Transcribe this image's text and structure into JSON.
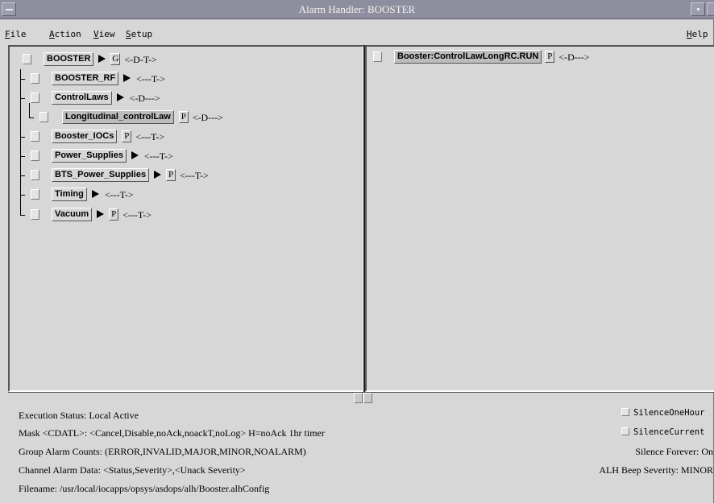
{
  "window": {
    "title": "Alarm Handler: BOOSTER"
  },
  "menu": {
    "file": "File",
    "action": "Action",
    "view": "View",
    "setup": "Setup",
    "help": "Help"
  },
  "tree": [
    {
      "label": "BOOSTER",
      "box": "G",
      "mask": "<-D-T->",
      "has_arrow": true,
      "selected": false
    },
    {
      "label": "BOOSTER_RF",
      "box": "",
      "mask": "<---T->",
      "has_arrow": true,
      "selected": false
    },
    {
      "label": "ControlLaws",
      "box": "",
      "mask": "<-D--->",
      "has_arrow": true,
      "selected": false
    },
    {
      "label": "Longitudinal_controlLaw",
      "box": "P",
      "mask": "<-D--->",
      "has_arrow": false,
      "selected": true
    },
    {
      "label": "Booster_IOCs",
      "box": "P",
      "mask": "<---T->",
      "has_arrow": false,
      "selected": false
    },
    {
      "label": "Power_Supplies",
      "box": "",
      "mask": "<---T->",
      "has_arrow": true,
      "selected": false
    },
    {
      "label": "BTS_Power_Supplies",
      "box": "P",
      "mask": "<---T->",
      "has_arrow": true,
      "selected": false
    },
    {
      "label": "Timing",
      "box": "",
      "mask": "<---T->",
      "has_arrow": true,
      "selected": false
    },
    {
      "label": "Vacuum",
      "box": "P",
      "mask": "<---T->",
      "has_arrow": true,
      "selected": false
    }
  ],
  "channels": [
    {
      "label": "Booster:ControlLawLongRC.RUN",
      "box": "P",
      "mask": "<-D--->"
    }
  ],
  "status": {
    "execution": "Execution Status:  Local Active",
    "mask": "Mask <CDATL>:  <Cancel,Disable,noAck,noackT,noLog>     H=noAck 1hr timer",
    "group_counts": "Group Alarm Counts:  (ERROR,INVALID,MAJOR,MINOR,NOALARM)",
    "channel_data": "Channel Alarm Data:  <Status,Severity>,<Unack Severity>",
    "filename": "Filename:   /usr/local/iocapps/opsys/asdops/alh/Booster.alhConfig"
  },
  "right_status": {
    "silence_one_hour": "SilenceOneHour",
    "silence_current": "SilenceCurrent",
    "silence_forever": "Silence Forever:  On",
    "beep_severity": "ALH Beep Severity:  MINOR"
  }
}
